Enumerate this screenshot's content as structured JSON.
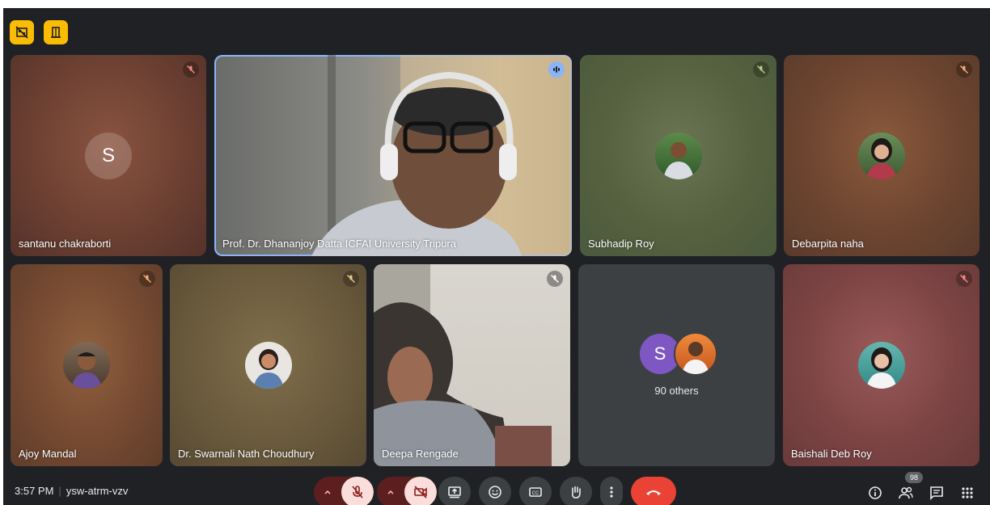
{
  "meeting": {
    "time": "3:57 PM",
    "separator": "|",
    "code": "ysw-atrm-vzv",
    "participant_count": "98"
  },
  "tiles": [
    {
      "name": "santanu chakraborti",
      "avatar_letter": "S"
    },
    {
      "name": "Prof. Dr. Dhananjoy Datta ICFAI University Tripura"
    },
    {
      "name": "Subhadip Roy"
    },
    {
      "name": "Debarpita naha"
    },
    {
      "name": "Ajoy Mandal"
    },
    {
      "name": "Dr. Swarnali Nath Choudhury"
    },
    {
      "name": "Deepa Rengade"
    },
    {
      "name": "Baishali Deb Roy"
    }
  ],
  "others": {
    "avatar_letter": "S",
    "label": "90 others"
  },
  "colors": {
    "background": "#202124",
    "accent_yellow": "#fbbc04",
    "end_call_red": "#ea4335",
    "active_speaker": "#8ab4f8"
  },
  "icons": {
    "top_left": [
      "hide-tiles-icon",
      "door-icon"
    ],
    "controls": [
      "mic-off-icon",
      "camera-off-icon",
      "present-icon",
      "emoji-icon",
      "captions-icon",
      "raise-hand-icon",
      "more-icon",
      "end-call-icon"
    ],
    "right": [
      "info-icon",
      "people-icon",
      "chat-icon",
      "activities-icon"
    ]
  }
}
